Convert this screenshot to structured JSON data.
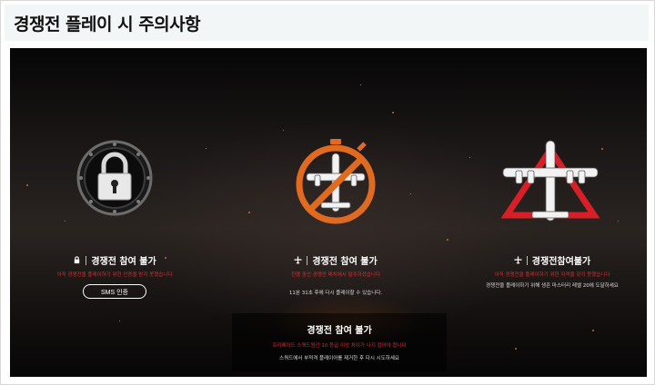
{
  "header": {
    "title": "경쟁전 플레이 시 주의사항"
  },
  "cards": [
    {
      "icon": "padlock-icon",
      "title": "경쟁전 참여 불가",
      "red_text": "아직 경쟁전을 플레이하기 위한 인증을 받지 못했습니다",
      "button_label": "SMS 인증"
    },
    {
      "icon": "prohibited-airplane-timer-icon",
      "title": "경쟁전 참여 불가",
      "red_text": "진행 중인 경쟁전 매치에서 탈주하셨습니다",
      "white_text": "11분 31초 후에 다시 플레이할 수 있습니다."
    },
    {
      "icon": "airplane-warning-triangle-icon",
      "title": "경쟁전참여불가",
      "red_text": "아직 경쟁전을 플레이하기 위한 자격을 갖지 못했습니다",
      "white_text": "경쟁전을 플레이하기 위해 생존 마스터리 레벨 20에 도달하세요"
    },
    {
      "title": "경쟁전 참여 불가",
      "red_text": "프리메이드 스쿼드원간 10 등급 이상 차이가 나지 않아야 합니다",
      "white_text": "스쿼드에서 부적격 플레이어를 제거한 후 다시 시도하세요"
    }
  ],
  "colors": {
    "accent_red": "#e02b2b",
    "orange": "#e06a1f",
    "background": "#1a1716"
  }
}
